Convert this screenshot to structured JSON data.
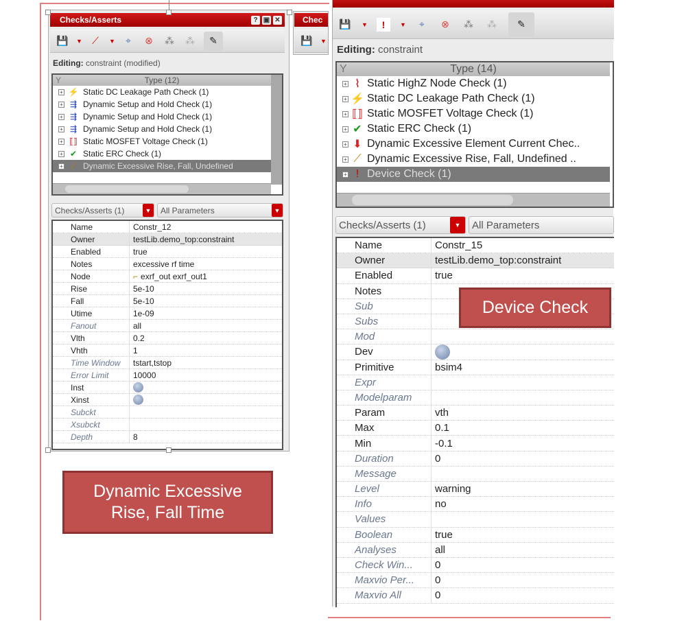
{
  "left_panel": {
    "title": "Checks/Asserts",
    "title_buttons": [
      "?",
      "▣",
      "✕"
    ],
    "editing_label": "Editing:",
    "editing_value": "constraint (modified)",
    "tree_header": "Type (12)",
    "tree_items": [
      {
        "icon": "dc-leakage-icon",
        "glyph": "⚡",
        "color": "#c00",
        "label": "Static DC Leakage Path Check (1)"
      },
      {
        "icon": "setup-hold-icon",
        "glyph": "⇶",
        "color": "#2040c0",
        "label": "Dynamic Setup and Hold Check (1)"
      },
      {
        "icon": "setup-hold-icon",
        "glyph": "⇶",
        "color": "#2040c0",
        "label": "Dynamic Setup and Hold Check (1)"
      },
      {
        "icon": "setup-hold-icon",
        "glyph": "⇶",
        "color": "#2040c0",
        "label": "Dynamic Setup and Hold Check (1)"
      },
      {
        "icon": "mosfet-voltage-icon",
        "glyph": "⟦⟧",
        "color": "#c00",
        "label": "Static MOSFET Voltage Check (1)"
      },
      {
        "icon": "checkmark-icon",
        "glyph": "✔",
        "color": "#1a9a1a",
        "label": "Static ERC Check (1)"
      },
      {
        "icon": "rise-fall-icon",
        "glyph": "⟋",
        "color": "#c08000",
        "label": "Dynamic Excessive Rise, Fall, Undefined",
        "selected": true
      }
    ],
    "combo_left": "Checks/Asserts (1)",
    "combo_right": "All Parameters",
    "properties": [
      {
        "key": "Name",
        "value": "Constr_12"
      },
      {
        "key": "Owner",
        "value": "testLib.demo_top:constraint",
        "highlight": true
      },
      {
        "key": "Enabled",
        "value": "true"
      },
      {
        "key": "Notes",
        "value": "excessive rf time"
      },
      {
        "key": "Node",
        "value": "exrf_out exrf_out1",
        "icon": "node-icon"
      },
      {
        "key": "Rise",
        "value": "5e-10"
      },
      {
        "key": "Fall",
        "value": "5e-10"
      },
      {
        "key": "Utime",
        "value": "1e-09"
      },
      {
        "key": "Fanout",
        "value": "all",
        "optional": true
      },
      {
        "key": "Vlth",
        "value": "0.2"
      },
      {
        "key": "Vhth",
        "value": "1"
      },
      {
        "key": "Time Window",
        "value": "tstart,tstop",
        "optional": true
      },
      {
        "key": "Error Limit",
        "value": "10000",
        "optional": true
      },
      {
        "key": "Inst",
        "value": "",
        "orb": true
      },
      {
        "key": "Xinst",
        "value": "",
        "orb": true
      },
      {
        "key": "Subckt",
        "value": "",
        "optional": true
      },
      {
        "key": "Xsubckt",
        "value": "",
        "optional": true
      },
      {
        "key": "Depth",
        "value": "8",
        "optional": true
      }
    ]
  },
  "middle_panel": {
    "title": "Chec"
  },
  "right_panel": {
    "editing_label": "Editing:",
    "editing_value": "constraint",
    "tree_header": "Type (14)",
    "tree_items": [
      {
        "icon": "highz-node-icon",
        "glyph": "⌇",
        "color": "#c00",
        "label": "Static HighZ Node Check (1)"
      },
      {
        "icon": "dc-leakage-icon",
        "glyph": "⚡",
        "color": "#c00",
        "label": "Static DC Leakage Path Check (1)"
      },
      {
        "icon": "mosfet-voltage-icon",
        "glyph": "⟦⟧",
        "color": "#c00",
        "label": "Static MOSFET Voltage Check (1)"
      },
      {
        "icon": "checkmark-icon",
        "glyph": "✔",
        "color": "#1a9a1a",
        "label": "Static ERC Check (1)"
      },
      {
        "icon": "element-current-icon",
        "glyph": "⬇",
        "color": "#e02020",
        "label": "Dynamic Excessive Element Current Chec.."
      },
      {
        "icon": "rise-fall-icon",
        "glyph": "⟋",
        "color": "#c08000",
        "label": "Dynamic Excessive Rise, Fall, Undefined .."
      },
      {
        "icon": "device-check-icon",
        "glyph": "!",
        "color": "#c00",
        "label": "Device Check (1)",
        "selected": true
      }
    ],
    "combo_left": "Checks/Asserts (1)",
    "combo_right": "All Parameters",
    "properties": [
      {
        "key": "Name",
        "value": "Constr_15"
      },
      {
        "key": "Owner",
        "value": "testLib.demo_top:constraint",
        "highlight": true
      },
      {
        "key": "Enabled",
        "value": "true"
      },
      {
        "key": "Notes",
        "value": ""
      },
      {
        "key": "Sub",
        "value": "",
        "optional": true
      },
      {
        "key": "Subs",
        "value": "",
        "optional": true
      },
      {
        "key": "Mod",
        "value": "",
        "optional": true
      },
      {
        "key": "Dev",
        "value": "",
        "orb": true
      },
      {
        "key": "Primitive",
        "value": "bsim4"
      },
      {
        "key": "Expr",
        "value": "",
        "optional": true
      },
      {
        "key": "Modelparam",
        "value": "",
        "optional": true
      },
      {
        "key": "Param",
        "value": "vth"
      },
      {
        "key": "Max",
        "value": "0.1"
      },
      {
        "key": "Min",
        "value": "-0.1"
      },
      {
        "key": "Duration",
        "value": "0",
        "optional": true
      },
      {
        "key": "Message",
        "value": "",
        "optional": true
      },
      {
        "key": "Level",
        "value": "warning",
        "optional": true
      },
      {
        "key": "Info",
        "value": "no",
        "optional": true
      },
      {
        "key": "Values",
        "value": "",
        "optional": true
      },
      {
        "key": "Boolean",
        "value": "true",
        "optional": true
      },
      {
        "key": "Analyses",
        "value": "all",
        "optional": true
      },
      {
        "key": "Check Win...",
        "value": "0",
        "optional": true
      },
      {
        "key": "Maxvio Per...",
        "value": "0",
        "optional": true
      },
      {
        "key": "Maxvio All",
        "value": "0",
        "optional": true
      }
    ]
  },
  "callouts": {
    "left": "Dynamic Excessive Rise, Fall Time",
    "right": "Device Check"
  }
}
